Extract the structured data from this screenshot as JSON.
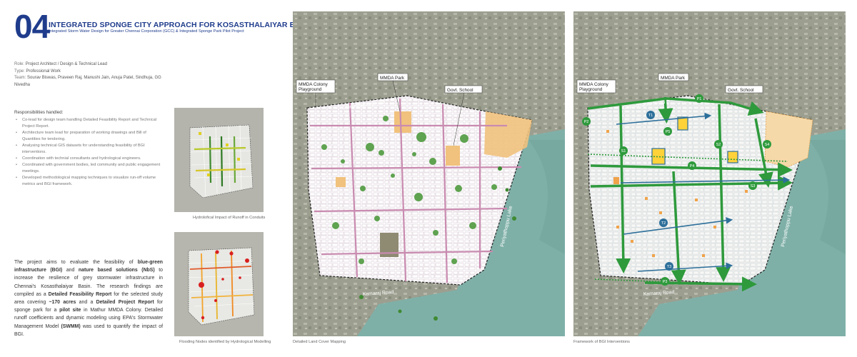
{
  "header": {
    "number": "04",
    "title": "INTEGRATED SPONGE CITY APPROACH FOR KOSASTHALAIYAR BASIN",
    "subtitle": "Integrated Storm Water Design for Greater Chennai Corporation (GCC) & Integrated Sponge Park Pilot Project"
  },
  "meta": {
    "role_label": "Role:",
    "role_value": "Project Architect / Design & Technical Lead",
    "type_label": "Type:",
    "type_value": "Professional Work",
    "team_label": "Team:",
    "team_value": "Sourav Biswas, Praveen Raj, Manushi Jain, Anuja Patel, Sindhuja, GG Nivedha"
  },
  "responsibilities": {
    "title": "Responsibilities handled:",
    "items": [
      "Co-lead for design team handling Detailed Feasibility Report and Technical Project Report.",
      "Architecture team lead for preparation of working drawings and Bill of Quantities for tendering.",
      "Analysing technical GIS datasets for understanding feasibility of BGI interventions.",
      "Coordination with technial consultants and hydrological engineers.",
      "Coordinated with government bodies, led community and public engagement meetings.",
      "Developed methodological mapping techniques to visualize run-off volume metrics and BGI framework."
    ]
  },
  "summary": {
    "p1": "The project aims to evaluate the feasibility of ",
    "b1": "blue-green infrastructure (BGI)",
    "p2": " and ",
    "b2": "nature based solutions (NbS)",
    "p3": " to increase the resilience of grey stormwater infrastructure in Chennai's Kosasthalaiyar Basin. The research findings are compiled as a ",
    "b3": "Detailed Feasibility Report",
    "p4": " for the selected study area covering ",
    "b4": "~170 acres",
    "p5": " and a ",
    "b5": "Detailed Project Report",
    "p6": " for sponge park for a ",
    "b6": "pilot site",
    "p7": " in Mathur MMDA Colony. Detailed runoff coefficients and dynamic modeling using EPA's Stormwater Management Model ",
    "b7": "(SWMM)",
    "p8": " was used to quantify the impact of BGI."
  },
  "captions": {
    "hydro": "Hydrolofical Impact of Runoff in Conduits",
    "flood": "Flooding Nodes identified by Hydrological Modelling",
    "landcover": "Detailed Land Cover Mapping",
    "bgi": "Framework of BGI Interventions"
  },
  "map_labels": {
    "mmda_colony": [
      "MMDA Colony",
      "Playground"
    ],
    "mmda_park": "MMDA Park",
    "govt_school": "Govt. School",
    "chinnamattur_road": "Chinnamattur Road",
    "kamaraj_road": "Kamaraj Road",
    "lake": "Periyathoppu Lake"
  },
  "bgi_markers": [
    "P1",
    "P2",
    "P3",
    "P4",
    "P5",
    "S1",
    "S2",
    "S3",
    "S4",
    "T1",
    "T2",
    "T3"
  ],
  "colors": {
    "brand_blue": "#1f3c8c",
    "satellite_base": "#9a9d8e",
    "water": "#7fb0a8",
    "road_pink": "#c98bb0",
    "vegetation": "#4f9a3f",
    "bgi_green": "#2e9a3c",
    "bgi_blue": "#2d6f9a",
    "open_space": "#f1c27d"
  }
}
